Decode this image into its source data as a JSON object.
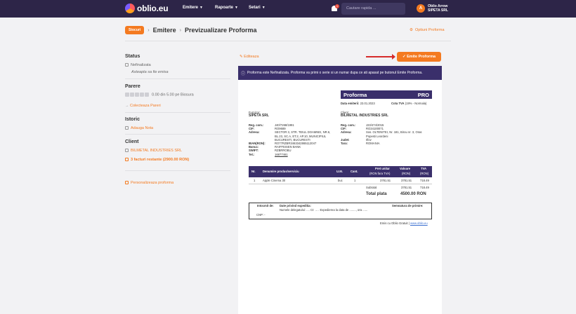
{
  "nav": {
    "brand": "oblio.eu",
    "emitere": "Emitere",
    "rapoarte": "Rapoarte",
    "setari": "Setari",
    "notif_count": "1",
    "search_placeholder": "Cautare rapida ...",
    "avatar_letter": "A",
    "user_name": "Oblio Arrow",
    "company": "SIPETA SRL"
  },
  "breadcrumb": {
    "badge": "Stocuri",
    "emitere": "Emitere",
    "current": "Previzualizare Proforma",
    "options": "Optiuni Proforma"
  },
  "sidebar": {
    "status_title": "Status",
    "status_value": "Nefinalizata",
    "status_note": "Asteapta sa fie emisa",
    "parere_title": "Parere",
    "rating": "0.00 din 5.00 pe Biosura",
    "colecteaza": "Colecteaza Pareri",
    "istoric_title": "Istoric",
    "adauga_nota": "Adauga Nota",
    "client_title": "Client",
    "client_name": "BILMETAL INDUSTRIES SRL",
    "facturi": "3 facturi restante (2900.00 RON)",
    "personalizeaza": "Personalizeaza proforma"
  },
  "actions": {
    "edit": "Editeaza",
    "emit": "Emite Proforma"
  },
  "notice": "Proforma este Nefinalizata. Proforma va primi o serie si un numar dupa ce ati apasat pe butonul Emite Proforma.",
  "doc": {
    "title": "Proforma",
    "pro": "PRO",
    "date_label": "Data emiterii:",
    "date": "23.01.2023",
    "tva_label": "Cota TVA",
    "tva": "(19% - Normala)",
    "supplier_label": "Furnizor:",
    "supplier": "SIPETA SRL",
    "client_label": "Client:",
    "client": "BILMETAL INDUSTRIES SRL",
    "s_keys": [
      "Reg. com.:",
      "CIF:",
      "Adresa:",
      "",
      "",
      "IBAN(RON):",
      "Banca:",
      "SWIFT:",
      "Tel.:"
    ],
    "s_vals": [
      "J40/7268/1991",
      "RO9689",
      "SECTOR 3, STR. TEIUL DOAMNEI, NR.6,",
      "BL.23, SC.A, ET.2, AP.10, MUNICIPIUL",
      "BUCURESTI, BUCURESTI",
      "RO77RZBR3463342865112047",
      "RAIFFEISEN BANK",
      "RZBRROBU",
      "16877461"
    ],
    "c_keys": [
      "Reg. com.:",
      "CIF:",
      "Adresa:",
      "",
      "Judet:",
      "Tara:"
    ],
    "c_vals": [
      "J23/474/2015",
      "RO34100071",
      "Sos. OLTENITEI, Nr. 181, Birou nr. 3, Oras",
      "Popesti Leordeni",
      "Ilfov",
      "ROMANIA"
    ],
    "cols": [
      "Nr.",
      "Denumire produs/serviciu",
      "U.M.",
      "Cant.",
      "Pret unitar",
      "Valoare",
      "TVA"
    ],
    "cols_sub": [
      "(RON fara TVA)",
      "(RON)",
      "(RON)"
    ],
    "row": [
      "1",
      "Apple Cinema 30",
      "buc",
      "1",
      "3781.51",
      "3781.51",
      "718.49"
    ],
    "subtotal_label": "Subtotal",
    "subtotal_val": "3781.51",
    "subtotal_tva": "718.49",
    "total_label": "Total plata",
    "total_val": "4500.00 RON",
    "intocmit": "Intocmit de:",
    "date_exp": "Date privind expeditia:",
    "semnatura": "Semnatura de primire:",
    "delegat": "Numele delegatului: .... CI: ... . Expedierea la data de ........, ora ......",
    "cnp": "CNP: -",
    "footer": "Emis cu Oblio Gratuit | ",
    "footer_link": "www.oblio.eu"
  }
}
